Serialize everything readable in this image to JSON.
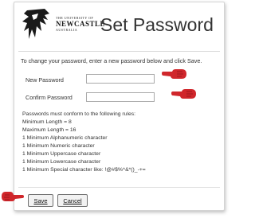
{
  "header": {
    "logo_line1": "THE UNIVERSITY OF",
    "logo_line2": "NEWCASTLE",
    "logo_line3": "AUSTRALIA",
    "title": "Set Password"
  },
  "form": {
    "intro": "To change your password, enter a new password below and click Save.",
    "new_password_label": "New Password",
    "confirm_password_label": "Confirm Password",
    "new_password_value": "",
    "confirm_password_value": ""
  },
  "rules": {
    "heading": "Passwords must conform to the following rules:",
    "items": [
      "Minimum Length = 8",
      "Maximum Length = 16",
      "1 Minimum Alphanumeric character",
      "1 Minimum Numeric character",
      "1 Minimum Uppercase character",
      "1 Minimum Lowercase character",
      "1 Minimum Special character like: !@#$%^&*()_-+="
    ]
  },
  "buttons": {
    "save": "Save",
    "cancel": "Cancel"
  },
  "icons": {
    "logo": "newcastle-seahorse-logo",
    "pointer": "red-pointing-hand-icon"
  },
  "colors": {
    "pointer_red": "#d0262b",
    "title_text": "#333333",
    "logo": "#1a1a1a"
  }
}
